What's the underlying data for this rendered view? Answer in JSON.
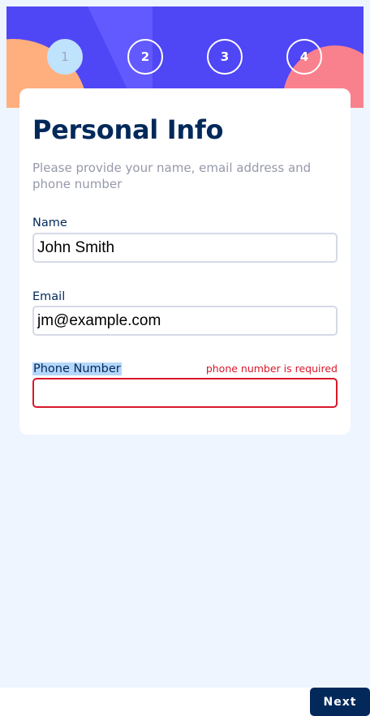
{
  "steps": [
    {
      "number": "1",
      "active": true
    },
    {
      "number": "2",
      "active": false
    },
    {
      "number": "3",
      "active": false
    },
    {
      "number": "4",
      "active": false
    }
  ],
  "form": {
    "title": "Personal Info",
    "subtitle": "Please provide your name, email address and phone number",
    "name": {
      "label": "Name",
      "value": "John Smith"
    },
    "email": {
      "label": "Email",
      "value": "jm@example.com"
    },
    "phone": {
      "label": "Phone Number",
      "value": "",
      "error": "phone number is required"
    }
  },
  "footer": {
    "next_label": "Next"
  },
  "colors": {
    "banner": "#4f46f5",
    "title": "#02295a",
    "error": "#d7182a",
    "next_button": "#022959",
    "background": "#eef5ff"
  }
}
